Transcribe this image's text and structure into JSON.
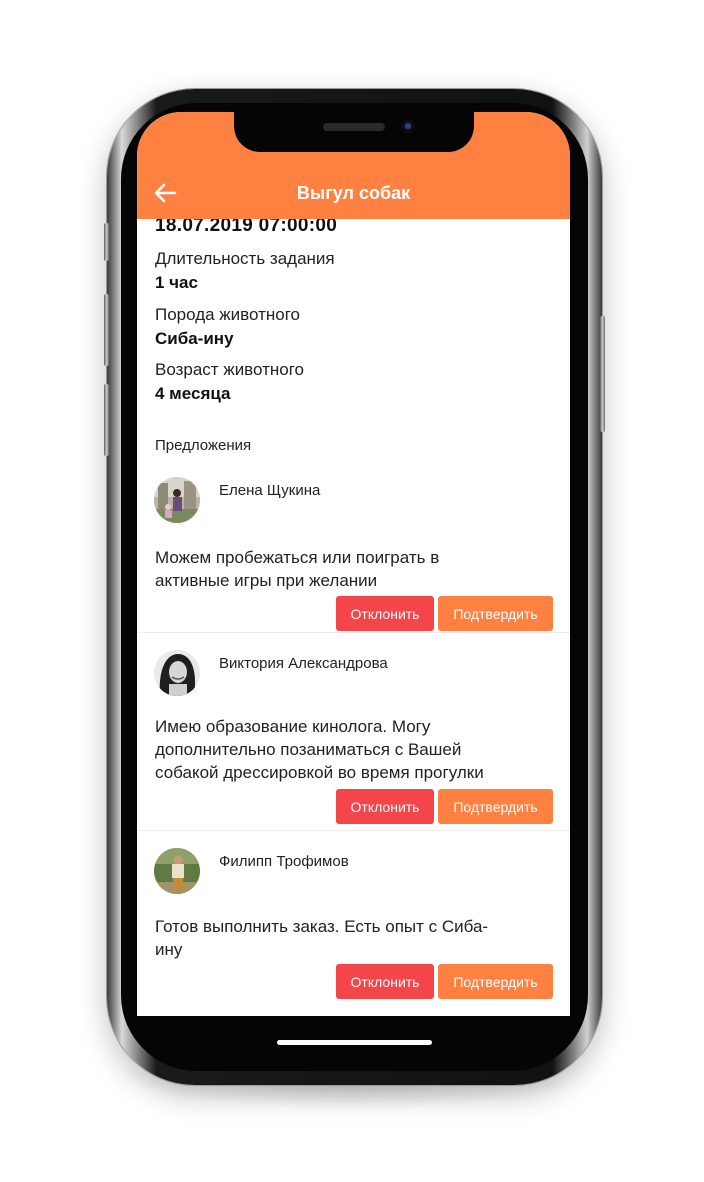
{
  "header": {
    "title": "Выгул собак",
    "back_icon": "arrow-left-icon",
    "color": "#ff8142"
  },
  "task": {
    "date": "18.07.2019 07:00:00",
    "fields": [
      {
        "label": "Длительность задания",
        "value": "1 час"
      },
      {
        "label": "Порода животного",
        "value": "Сиба-ину"
      },
      {
        "label": "Возраст животного",
        "value": "4 месяца"
      }
    ]
  },
  "offers": {
    "title": "Предложения",
    "items": [
      {
        "name": "Елена Щукина",
        "message_lines": [
          "Можем пробежаться или поиграть в",
          "активные игры при желании"
        ],
        "decline_label": "Отклонить",
        "confirm_label": "Подтвердить"
      },
      {
        "name": "Виктория Александрова",
        "message_lines": [
          "Имею образование кинолога. Могу",
          "дополнительно позаниматься с Вашей",
          "собакой дрессировкой во время прогулки"
        ],
        "decline_label": "Отклонить",
        "confirm_label": "Подтвердить"
      },
      {
        "name": "Филипп Трофимов",
        "message_lines": [
          "Готов выполнить заказ. Есть опыт с Сиба-",
          "ину"
        ],
        "decline_label": "Отклонить",
        "confirm_label": "Подтвердить"
      }
    ]
  },
  "colors": {
    "accent": "#ff8142",
    "decline": "#f4454a"
  }
}
